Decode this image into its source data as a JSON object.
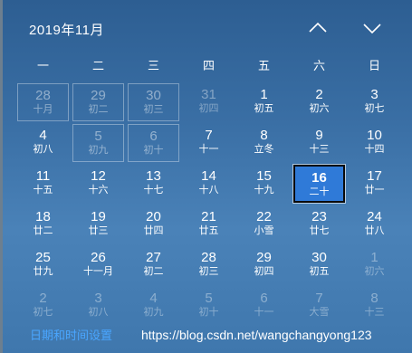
{
  "header": {
    "month_title": "2019年11月",
    "prev_icon": "chevron-up-icon",
    "next_icon": "chevron-down-icon"
  },
  "weekdays": [
    "一",
    "二",
    "三",
    "四",
    "五",
    "六",
    "日"
  ],
  "days": [
    {
      "num": "28",
      "lunar": "十月",
      "state": "prev",
      "outlined": true
    },
    {
      "num": "29",
      "lunar": "初二",
      "state": "prev",
      "outlined": true
    },
    {
      "num": "30",
      "lunar": "初三",
      "state": "prev",
      "outlined": true
    },
    {
      "num": "31",
      "lunar": "初四",
      "state": "prev"
    },
    {
      "num": "1",
      "lunar": "初五",
      "state": "current"
    },
    {
      "num": "2",
      "lunar": "初六",
      "state": "current"
    },
    {
      "num": "3",
      "lunar": "初七",
      "state": "current"
    },
    {
      "num": "4",
      "lunar": "初八",
      "state": "current"
    },
    {
      "num": "5",
      "lunar": "初九",
      "state": "current",
      "outlined": true
    },
    {
      "num": "6",
      "lunar": "初十",
      "state": "current",
      "outlined": true
    },
    {
      "num": "7",
      "lunar": "十一",
      "state": "current"
    },
    {
      "num": "8",
      "lunar": "立冬",
      "state": "current"
    },
    {
      "num": "9",
      "lunar": "十三",
      "state": "current"
    },
    {
      "num": "10",
      "lunar": "十四",
      "state": "current"
    },
    {
      "num": "11",
      "lunar": "十五",
      "state": "current"
    },
    {
      "num": "12",
      "lunar": "十六",
      "state": "current"
    },
    {
      "num": "13",
      "lunar": "十七",
      "state": "current"
    },
    {
      "num": "14",
      "lunar": "十八",
      "state": "current"
    },
    {
      "num": "15",
      "lunar": "十九",
      "state": "current"
    },
    {
      "num": "16",
      "lunar": "二十",
      "state": "today"
    },
    {
      "num": "17",
      "lunar": "廿一",
      "state": "current"
    },
    {
      "num": "18",
      "lunar": "廿二",
      "state": "current"
    },
    {
      "num": "19",
      "lunar": "廿三",
      "state": "current"
    },
    {
      "num": "20",
      "lunar": "廿四",
      "state": "current"
    },
    {
      "num": "21",
      "lunar": "廿五",
      "state": "current"
    },
    {
      "num": "22",
      "lunar": "小雪",
      "state": "current"
    },
    {
      "num": "23",
      "lunar": "廿七",
      "state": "current"
    },
    {
      "num": "24",
      "lunar": "廿八",
      "state": "current"
    },
    {
      "num": "25",
      "lunar": "廿九",
      "state": "current"
    },
    {
      "num": "26",
      "lunar": "十一月",
      "state": "current"
    },
    {
      "num": "27",
      "lunar": "初二",
      "state": "current"
    },
    {
      "num": "28",
      "lunar": "初三",
      "state": "current"
    },
    {
      "num": "29",
      "lunar": "初四",
      "state": "current"
    },
    {
      "num": "30",
      "lunar": "初五",
      "state": "current"
    },
    {
      "num": "1",
      "lunar": "初六",
      "state": "next"
    },
    {
      "num": "2",
      "lunar": "初七",
      "state": "next"
    },
    {
      "num": "3",
      "lunar": "初八",
      "state": "next"
    },
    {
      "num": "4",
      "lunar": "初九",
      "state": "next"
    },
    {
      "num": "5",
      "lunar": "初十",
      "state": "next"
    },
    {
      "num": "6",
      "lunar": "十一",
      "state": "next"
    },
    {
      "num": "7",
      "lunar": "大雪",
      "state": "next"
    },
    {
      "num": "8",
      "lunar": "十三",
      "state": "next"
    }
  ],
  "footer": {
    "settings_link": "日期和时间设置"
  },
  "watermark": "https://blog.csdn.net/wangchangyong123",
  "colors": {
    "today_fill": "#2f7ad8",
    "link": "#4aa6ff"
  }
}
